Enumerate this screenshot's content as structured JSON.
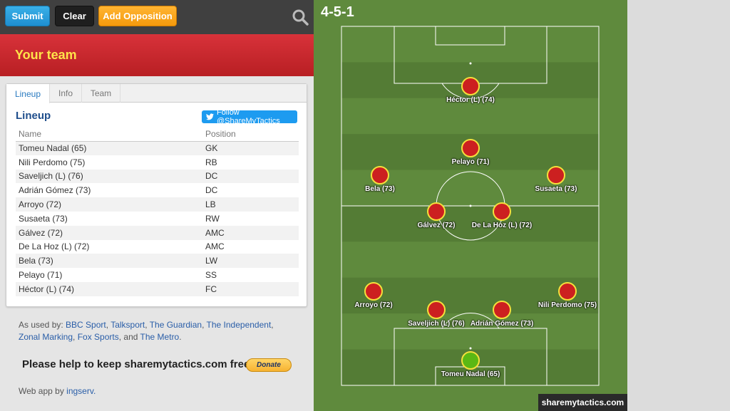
{
  "toolbar": {
    "submit": "Submit",
    "clear": "Clear",
    "add_opposition": "Add Opposition"
  },
  "banner": {
    "title": "Your team"
  },
  "tabs": [
    "Lineup",
    "Info",
    "Team"
  ],
  "lineup": {
    "heading": "Lineup",
    "follow": "Follow @ShareMyTactics",
    "columns": [
      "Name",
      "Position"
    ],
    "rows": [
      [
        "Tomeu Nadal (65)",
        "GK"
      ],
      [
        "Nili Perdomo (75)",
        "RB"
      ],
      [
        "Saveljich (L) (76)",
        "DC"
      ],
      [
        "Adrián Gómez (73)",
        "DC"
      ],
      [
        "Arroyo (72)",
        "LB"
      ],
      [
        "Susaeta (73)",
        "RW"
      ],
      [
        "Gálvez (72)",
        "AMC"
      ],
      [
        "De La Hoz (L) (72)",
        "AMC"
      ],
      [
        "Bela (73)",
        "LW"
      ],
      [
        "Pelayo (71)",
        "SS"
      ],
      [
        "Héctor (L) (74)",
        "FC"
      ]
    ]
  },
  "footer": {
    "used_by_prefix": "As used by: ",
    "used_by_links": [
      "BBC Sport",
      "Talksport",
      "The Guardian",
      "The Independent",
      "Zonal Marking",
      "Fox Sports"
    ],
    "used_by_and": ", and ",
    "used_by_last": "The Metro",
    "help_text": "Please help to keep sharemytactics.com free",
    "donate": "Donate",
    "credit_prefix": "Web app by ",
    "credit_link": "ingserv."
  },
  "pitch": {
    "formation": "4-5-1",
    "watermark": "sharemytactics.com",
    "colors": {
      "grass": "#5f8a3d",
      "player": "#cc2020",
      "keeper": "#5ab814",
      "ring": "#f5e03c"
    }
  },
  "players": [
    {
      "name": "Héctor (L) (74)",
      "gk": false
    },
    {
      "name": "Pelayo (71)",
      "gk": false
    },
    {
      "name": "Bela (73)",
      "gk": false
    },
    {
      "name": "Susaeta (73)",
      "gk": false
    },
    {
      "name": "Gálvez (72)",
      "gk": false
    },
    {
      "name": "De La Hoz (L) (72)",
      "gk": false
    },
    {
      "name": "Arroyo (72)",
      "gk": false
    },
    {
      "name": "Nili Perdomo (75)",
      "gk": false
    },
    {
      "name": "Saveljich (L) (76)",
      "gk": false
    },
    {
      "name": "Adrián Gómez (73)",
      "gk": false
    },
    {
      "name": "Tomeu Nadal (65)",
      "gk": true
    }
  ]
}
